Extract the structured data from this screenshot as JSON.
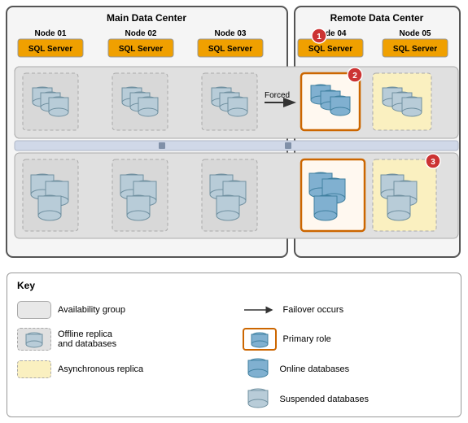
{
  "diagram": {
    "mainDC": {
      "title": "Main Data Center",
      "nodes": [
        {
          "label": "Node 01"
        },
        {
          "label": "Node 02"
        },
        {
          "label": "Node 03"
        }
      ]
    },
    "remoteDC": {
      "title": "Remote Data Center",
      "nodes": [
        {
          "label": "Node 04",
          "badge": "1"
        },
        {
          "label": "Node 05"
        }
      ]
    },
    "sqlBadge": "SQL Server",
    "forcedLabel": "Forced",
    "badges": [
      "1",
      "2",
      "3"
    ]
  },
  "legend": {
    "title": "Key",
    "items": [
      {
        "id": "ag",
        "label": "Availability group"
      },
      {
        "id": "failover",
        "label": "Failover occurs"
      },
      {
        "id": "offline",
        "label": "Offline replica\nand databases"
      },
      {
        "id": "primary",
        "label": "Primary role"
      },
      {
        "id": "async",
        "label": "Asynchronous replica"
      },
      {
        "id": "online-db",
        "label": "Online databases"
      },
      {
        "id": "suspended-db",
        "label": "Suspended databases"
      }
    ]
  }
}
